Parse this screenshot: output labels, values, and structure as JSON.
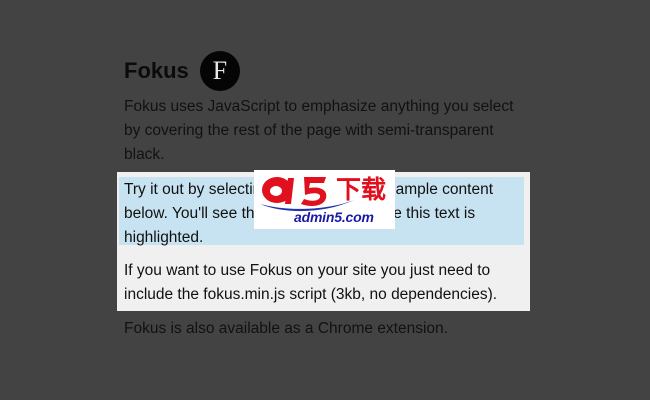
{
  "header": {
    "title": "Fokus",
    "logo_letter": "F"
  },
  "content": {
    "intro": "Fokus uses JavaScript to emphasize anything you select by covering the rest of the page with semi-transparent black.",
    "try_it": "Try it out by selecting some text in the sample content below. You'll see the page fade out while this text is highlighted.",
    "usage": "If you want to use Fokus on your site you just need to include the fokus.min.js script (3kb, no dependencies).",
    "chrome": "Fokus is also available as a Chrome extension."
  },
  "watermark": {
    "chinese": "下载",
    "domain": "admin5.com"
  },
  "colors": {
    "overlay": "#434343",
    "focus_background": "#f0f0f0",
    "selection": "#c7e2f1",
    "watermark_red": "#e0101e",
    "watermark_blue": "#1a1aa6"
  }
}
